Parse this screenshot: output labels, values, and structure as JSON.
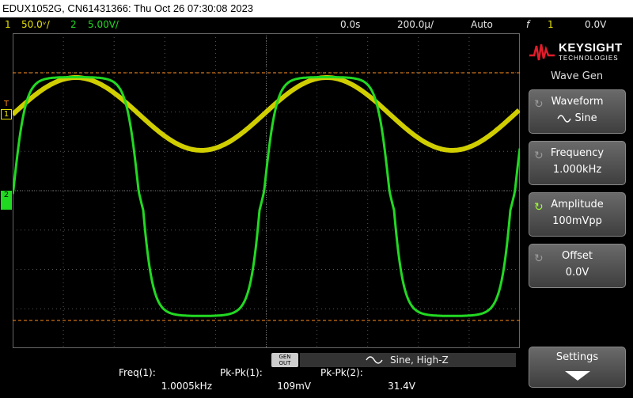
{
  "titlebar": {
    "text": "EDUX1052G, CN61431366: Thu Oct 26 07:30:08 2023"
  },
  "status": {
    "ch1_num": "1",
    "ch1_scale": "50.0ᵛ/",
    "ch2_num": "2",
    "ch2_scale": "5.00V/",
    "time_delay": "0.0s",
    "time_scale": "200.0µ/",
    "trigger_mode": "Auto",
    "trig_icon": "f",
    "trig_source": "1",
    "trig_level": "0.0V"
  },
  "brand": {
    "name": "KEYSIGHT",
    "sub": "TECHNOLOGIES"
  },
  "menu": {
    "title": "Wave Gen",
    "keys": [
      {
        "label": "Waveform",
        "value": "Sine",
        "icon": "sine-icon"
      },
      {
        "label": "Frequency",
        "value": "1.000kHz"
      },
      {
        "label": "Amplitude",
        "value": "100mVpp"
      },
      {
        "label": "Offset",
        "value": "0.0V"
      },
      {
        "label": "Settings",
        "value": ""
      }
    ]
  },
  "channel_markers": {
    "ch1": "1",
    "ch2": "2",
    "trig": "T"
  },
  "genout": {
    "line1": "GEN",
    "line2": "OUT"
  },
  "wavegen_status": "Sine, High-Z",
  "measurements": [
    {
      "label": "Freq(1):",
      "value": "1.0005kHz"
    },
    {
      "label": "Pk-Pk(1):",
      "value": "109mV"
    },
    {
      "label": "Pk-Pk(2):",
      "value": "31.4V"
    }
  ],
  "colors": {
    "ch1": "#e8e400",
    "ch2": "#22d922",
    "cursor": "#ff8c1a"
  }
}
